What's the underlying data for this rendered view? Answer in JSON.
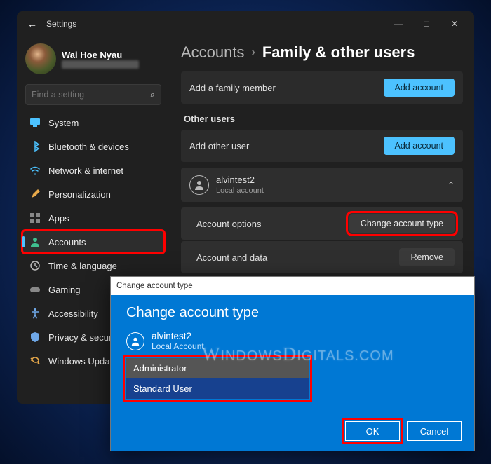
{
  "window": {
    "title": "Settings",
    "controls": {
      "min": "—",
      "max": "□",
      "close": "✕"
    }
  },
  "profile": {
    "name": "Wai Hoe Nyau"
  },
  "search": {
    "placeholder": "Find a setting"
  },
  "nav": {
    "system": "System",
    "bluetooth": "Bluetooth & devices",
    "network": "Network & internet",
    "personalization": "Personalization",
    "apps": "Apps",
    "accounts": "Accounts",
    "time": "Time & language",
    "gaming": "Gaming",
    "accessibility": "Accessibility",
    "privacy": "Privacy & security",
    "update": "Windows Update"
  },
  "breadcrumb": {
    "parent": "Accounts",
    "current": "Family & other users"
  },
  "rows": {
    "add_family": "Add a family member",
    "add_family_btn": "Add account",
    "other_users_header": "Other users",
    "add_other": "Add other user",
    "add_other_btn": "Add account",
    "user_name": "alvintest2",
    "user_sub": "Local account",
    "account_options": "Account options",
    "change_type_btn": "Change account type",
    "account_data": "Account and data",
    "remove_btn": "Remove"
  },
  "dialog": {
    "title": "Change account type",
    "heading": "Change account type",
    "user_name": "alvintest2",
    "user_type": "Local Account",
    "option_admin": "Administrator",
    "option_std": "Standard User",
    "ok": "OK",
    "cancel": "Cancel"
  },
  "watermark": "WindowsDigitals.com"
}
